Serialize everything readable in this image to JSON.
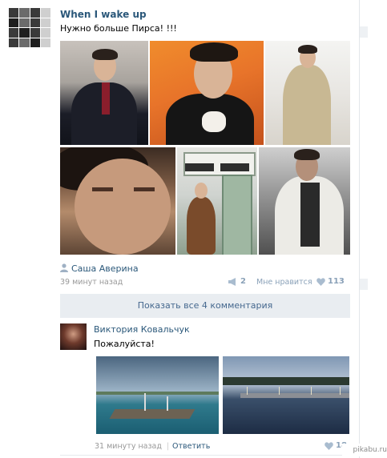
{
  "post": {
    "group_name": "When I wake up",
    "text": "Нужно больше Пирса! !!!",
    "author": "Саша Аверина",
    "time": "39 минут назад",
    "shares": "2",
    "like_label": "Мне нравится",
    "likes": "113"
  },
  "comments": {
    "show_all_label": "Показать все 4 комментария",
    "items": [
      {
        "author": "Виктория Ковальчук",
        "text": "Пожалуйста!",
        "time": "31 минуту назад",
        "separator": "|",
        "reply_label": "Ответить",
        "likes": "18"
      }
    ]
  },
  "watermark": "pikabu.ru",
  "colors": {
    "link": "#2b587a",
    "meta": "#999999",
    "counter": "#8aa1b8",
    "show_comments_bg": "#e9edf1"
  },
  "icons": [
    "group-avatar-mosaic",
    "user-icon",
    "megaphone-icon",
    "heart-icon"
  ]
}
